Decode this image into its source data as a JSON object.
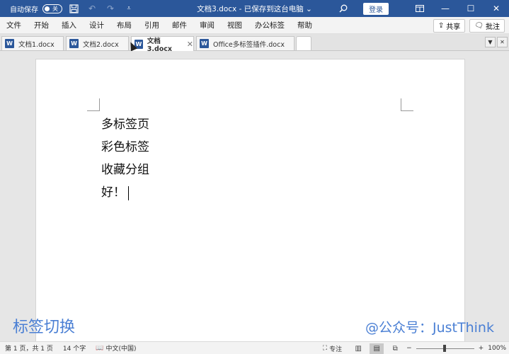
{
  "titlebar": {
    "autosave_label": "自动保存",
    "autosave_state": "关",
    "title": "文档3.docx - 已保存到这台电脑",
    "title_caret": "⌄",
    "login": "登录",
    "icons": [
      "save-icon",
      "undo-icon",
      "redo-icon",
      "customize-icon",
      "search-icon",
      "ribbon-display-icon",
      "minimize-icon",
      "maximize-icon",
      "close-icon"
    ]
  },
  "menu": {
    "items": [
      "文件",
      "开始",
      "插入",
      "设计",
      "布局",
      "引用",
      "邮件",
      "审阅",
      "视图",
      "办公标签",
      "帮助"
    ],
    "share": "共享",
    "comments": "批注"
  },
  "tabs": [
    {
      "label": "文档1.docx",
      "active": false
    },
    {
      "label": "文档2.docx",
      "active": false
    },
    {
      "label": "文档3.docx",
      "active": true
    },
    {
      "label": "Office多标签插件.docx",
      "active": false
    }
  ],
  "document": {
    "lines": [
      "多标签页",
      "彩色标签",
      "收藏分组",
      "好！"
    ]
  },
  "overlay": {
    "left": "标签切换",
    "right": "@公众号：JustThink"
  },
  "status": {
    "page": "第 1 页，共 1 页",
    "words": "14 个字",
    "language": "中文(中国)",
    "focus": "专注",
    "zoom": "100%",
    "zoom_minus": "−",
    "zoom_plus": "+"
  },
  "colors": {
    "titlebar": "#2b579a",
    "overlay_text": "#4a7fd4"
  }
}
